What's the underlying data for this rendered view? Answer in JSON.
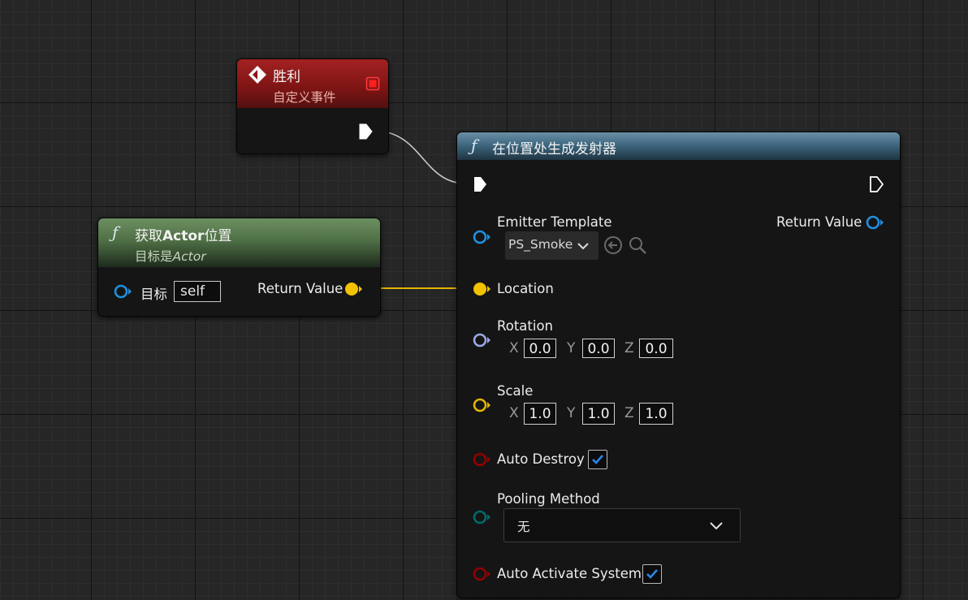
{
  "custom_event_node": {
    "title": "胜利",
    "subtitle": "自定义事件"
  },
  "get_actor_location_node": {
    "title_prefix": "获取",
    "title_bold": "Actor",
    "title_suffix": "位置",
    "subtitle_prefix": "目标是",
    "subtitle_italic": "Actor",
    "target_label": "目标",
    "target_value": "self",
    "return_label": "Return Value"
  },
  "spawn_emitter_node": {
    "title": "在位置处生成发射器",
    "emitter_template_label": "Emitter Template",
    "emitter_template_value": "PS_Smoke",
    "return_value_label": "Return Value",
    "location_label": "Location",
    "rotation_label": "Rotation",
    "rotation": {
      "x": "0.0",
      "y": "0.0",
      "z": "0.0"
    },
    "scale_label": "Scale",
    "scale": {
      "x": "1.0",
      "y": "1.0",
      "z": "1.0"
    },
    "axis_labels": {
      "x": "X",
      "y": "Y",
      "z": "Z"
    },
    "auto_destroy_label": "Auto Destroy",
    "auto_destroy_checked": true,
    "pooling_method_label": "Pooling Method",
    "pooling_method_value": "无",
    "auto_activate_label": "Auto Activate System",
    "auto_activate_checked": true
  },
  "colors": {
    "exec_pin": "#ffffff",
    "vector_pin": "#f2c200",
    "rotator_pin": "#9aa8e6",
    "object_pin": "#1e90e0",
    "bool_pin": "#950000",
    "enum_pin": "#006a6a",
    "check_accent": "#2a86e8",
    "event_header": "#8e1414",
    "function_header": "#3e6880",
    "pure_function_header": "#4f7046"
  }
}
